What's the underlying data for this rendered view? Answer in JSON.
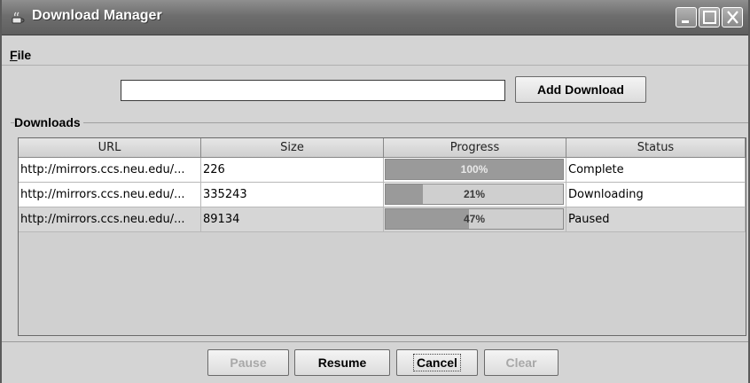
{
  "window": {
    "title": "Download Manager",
    "icon": "java-cup-icon",
    "controls": [
      "minimize-icon",
      "maximize-icon",
      "close-icon"
    ]
  },
  "menu": {
    "file_mnemonic": "F",
    "file_rest": "ile"
  },
  "add_download": {
    "url_value": "",
    "button_label": "Add Download"
  },
  "downloads": {
    "group_title": "Downloads",
    "columns": [
      "URL",
      "Size",
      "Progress",
      "Status"
    ],
    "rows": [
      {
        "url": "http://mirrors.ccs.neu.edu/...",
        "size": "226",
        "progress_label": "100%",
        "progress_value": 1.0,
        "status": "Complete"
      },
      {
        "url": "http://mirrors.ccs.neu.edu/...",
        "size": "335243",
        "progress_label": "21%",
        "progress_value": 0.21,
        "status": "Downloading"
      },
      {
        "url": "http://mirrors.ccs.neu.edu/...",
        "size": "89134",
        "progress_label": "47%",
        "progress_value": 0.47,
        "status": "Paused"
      }
    ]
  },
  "actions": {
    "pause": "Pause",
    "resume": "Resume",
    "cancel": "Cancel",
    "clear": "Clear"
  }
}
